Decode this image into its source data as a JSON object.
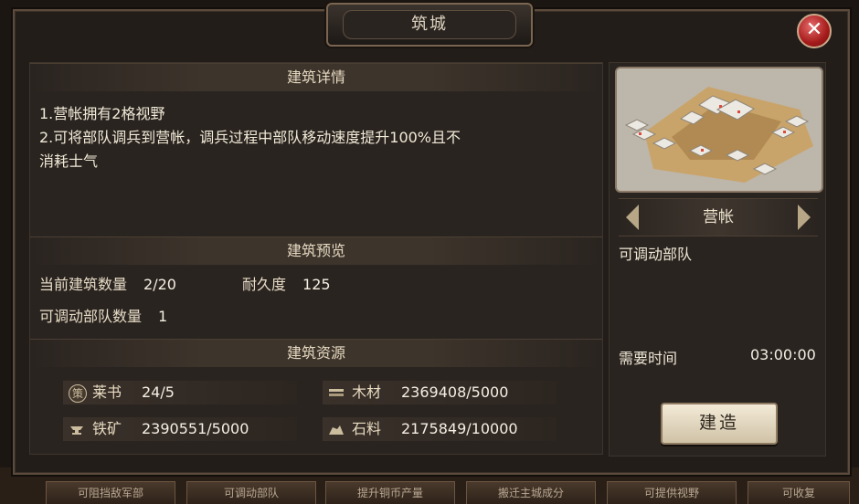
{
  "dialog": {
    "title": "筑城",
    "close_label": "✕"
  },
  "details": {
    "section_title": "建筑详情",
    "lines": [
      "1.营帐拥有2格视野",
      "2.可将部队调兵到营帐，调兵过程中部队移动速度提升100%且不",
      "消耗士气"
    ]
  },
  "preview": {
    "section_title": "建筑预览",
    "count_label": "当前建筑数量",
    "count_value": "2/20",
    "durability_label": "耐久度",
    "durability_value": "125",
    "troops_label": "可调动部队数量",
    "troops_value": "1"
  },
  "resources": {
    "section_title": "建筑资源",
    "items": [
      {
        "name": "莱书",
        "value": "24/5",
        "icon": "book-token-icon"
      },
      {
        "name": "木材",
        "value": "2369408/5000",
        "icon": "wood-icon"
      },
      {
        "name": "铁矿",
        "value": "2390551/5000",
        "icon": "iron-anvil-icon"
      },
      {
        "name": "石料",
        "value": "2175849/10000",
        "icon": "stone-icon"
      }
    ],
    "book_glyph": "策"
  },
  "building": {
    "name": "营帐",
    "effect": "可调动部队",
    "time_label": "需要时间",
    "time_value": "03:00:00",
    "build_label": "建造"
  },
  "background_tabs": [
    "可阻挡敌军部",
    "可调动部队",
    "提升铜币产量",
    "搬迁主城成分",
    "可提供视野",
    "可收复"
  ]
}
